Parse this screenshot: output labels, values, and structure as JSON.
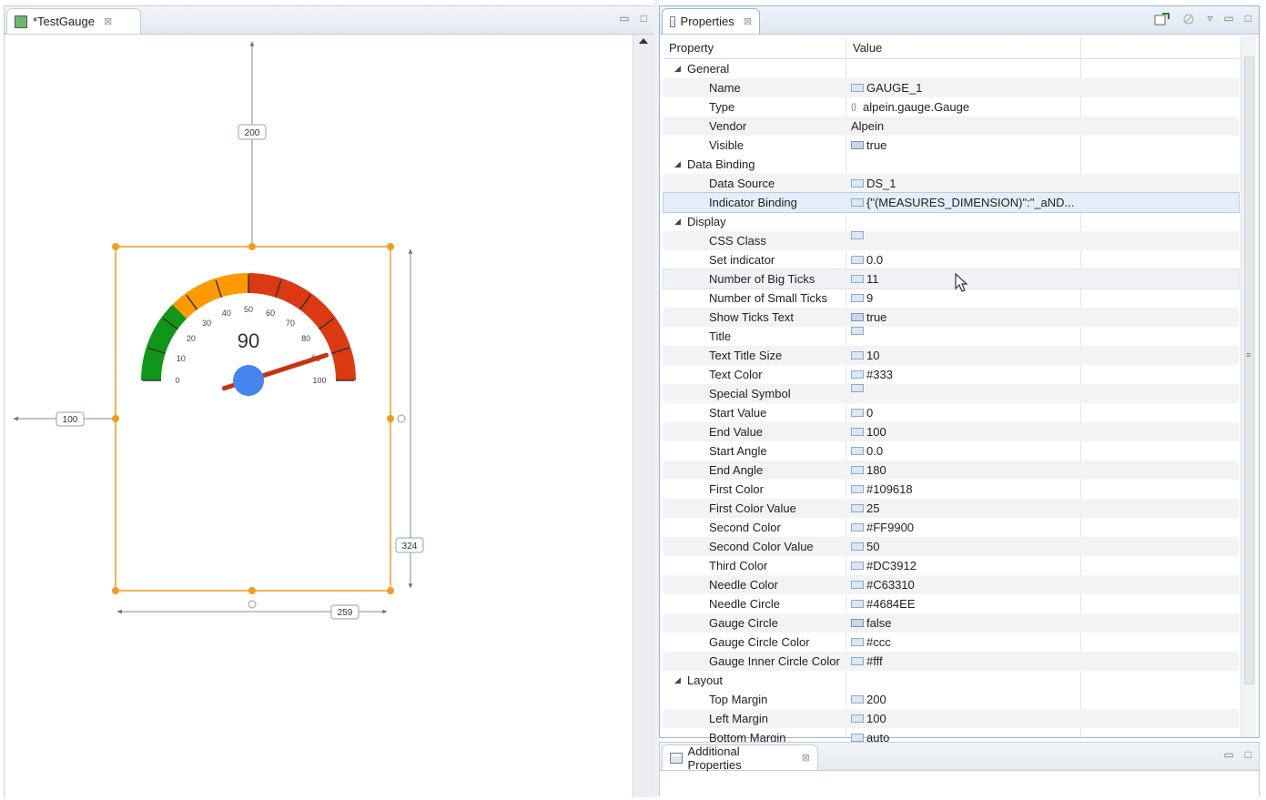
{
  "editor": {
    "tab_title": "*TestGauge",
    "tab_close": "⊠",
    "min_icon": "▭",
    "max_icon": "□"
  },
  "canvas": {
    "dim_top_margin": "200",
    "dim_left_margin": "100",
    "dim_height": "324",
    "dim_width": "259"
  },
  "gauge": {
    "value_text": "90",
    "start_value": 0,
    "end_value": 100,
    "first_color_value": 25,
    "second_color_value": 50,
    "needle_value": 90,
    "first_color": "#109618",
    "second_color": "#FF9900",
    "third_color": "#DC3912",
    "needle_color": "#C63310",
    "needle_circle": "#4684EE",
    "tick_labels": [
      "0",
      "10",
      "20",
      "30",
      "40",
      "50",
      "60",
      "70",
      "80",
      "90",
      "100"
    ]
  },
  "properties": {
    "tab_title": "Properties",
    "tab_close": "⊠",
    "header": {
      "property": "Property",
      "value": "Value"
    },
    "rows": [
      {
        "kind": "cat",
        "label": "General"
      },
      {
        "kind": "prop",
        "label": "Name",
        "icon": "string-icon",
        "value": "GAUGE_1"
      },
      {
        "kind": "prop",
        "label": "Type",
        "icon": "object-icon",
        "value": "alpein.gauge.Gauge"
      },
      {
        "kind": "prop",
        "label": "Vendor",
        "icon": "",
        "value": "Alpein"
      },
      {
        "kind": "prop",
        "label": "Visible",
        "icon": "boolean-icon",
        "value": "true"
      },
      {
        "kind": "cat",
        "label": "Data Binding"
      },
      {
        "kind": "prop",
        "label": "Data Source",
        "icon": "string-icon",
        "value": "DS_1"
      },
      {
        "kind": "prop",
        "label": "Indicator Binding",
        "icon": "string-icon",
        "value": "{\"(MEASURES_DIMENSION)\":\"_aND...",
        "state": "selected"
      },
      {
        "kind": "cat",
        "label": "Display"
      },
      {
        "kind": "prop",
        "label": "CSS Class",
        "icon": "string-icon",
        "value": ""
      },
      {
        "kind": "prop",
        "label": "Set indicator",
        "icon": "number-icon",
        "value": "0.0"
      },
      {
        "kind": "prop",
        "label": "Number of Big Ticks",
        "icon": "number-icon",
        "value": "11",
        "state": "hover"
      },
      {
        "kind": "prop",
        "label": "Number of Small Ticks",
        "icon": "number-icon",
        "value": "9"
      },
      {
        "kind": "prop",
        "label": "Show Ticks Text",
        "icon": "boolean-icon",
        "value": "true"
      },
      {
        "kind": "prop",
        "label": "Title",
        "icon": "string-icon",
        "value": ""
      },
      {
        "kind": "prop",
        "label": "Text Title Size",
        "icon": "number-icon",
        "value": "10"
      },
      {
        "kind": "prop",
        "label": "Text Color",
        "icon": "string-icon",
        "value": "#333"
      },
      {
        "kind": "prop",
        "label": "Special Symbol",
        "icon": "string-icon",
        "value": ""
      },
      {
        "kind": "prop",
        "label": "Start Value",
        "icon": "number-icon",
        "value": "0"
      },
      {
        "kind": "prop",
        "label": "End Value",
        "icon": "number-icon",
        "value": "100"
      },
      {
        "kind": "prop",
        "label": "Start Angle",
        "icon": "number-icon",
        "value": "0.0"
      },
      {
        "kind": "prop",
        "label": "End Angle",
        "icon": "number-icon",
        "value": "180"
      },
      {
        "kind": "prop",
        "label": "First Color",
        "icon": "string-icon",
        "value": "#109618"
      },
      {
        "kind": "prop",
        "label": "First Color Value",
        "icon": "number-icon",
        "value": "25"
      },
      {
        "kind": "prop",
        "label": "Second Color",
        "icon": "string-icon",
        "value": "#FF9900"
      },
      {
        "kind": "prop",
        "label": "Second Color Value",
        "icon": "number-icon",
        "value": "50"
      },
      {
        "kind": "prop",
        "label": "Third Color",
        "icon": "string-icon",
        "value": "#DC3912"
      },
      {
        "kind": "prop",
        "label": "Needle Color",
        "icon": "string-icon",
        "value": "#C63310"
      },
      {
        "kind": "prop",
        "label": "Needle Circle",
        "icon": "string-icon",
        "value": "#4684EE"
      },
      {
        "kind": "prop",
        "label": "Gauge Circle",
        "icon": "boolean-icon",
        "value": "false"
      },
      {
        "kind": "prop",
        "label": "Gauge Circle Color",
        "icon": "string-icon",
        "value": "#ccc"
      },
      {
        "kind": "prop",
        "label": "Gauge Inner Circle Color",
        "icon": "string-icon",
        "value": "#fff"
      },
      {
        "kind": "cat",
        "label": "Layout"
      },
      {
        "kind": "prop",
        "label": "Top Margin",
        "icon": "string-icon",
        "value": "200"
      },
      {
        "kind": "prop",
        "label": "Left Margin",
        "icon": "string-icon",
        "value": "100"
      },
      {
        "kind": "prop",
        "label": "Bottom Margin",
        "icon": "string-icon",
        "value": "auto"
      }
    ]
  },
  "additional": {
    "tab_title": "Additional Properties",
    "tab_close": "⊠"
  }
}
